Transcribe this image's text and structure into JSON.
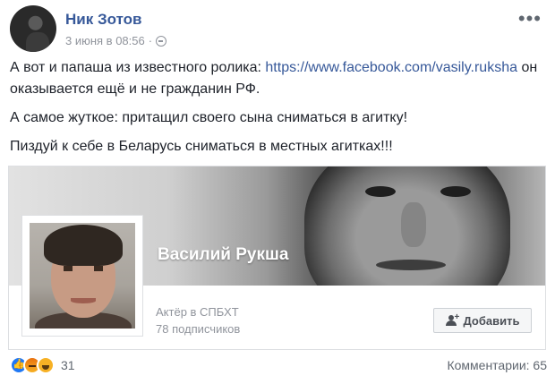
{
  "post": {
    "author": "Ник Зотов",
    "date": "3 июня в 08:56",
    "meta_separator": "·",
    "more_label": "•••"
  },
  "text": {
    "line1_before": "А вот и папаша из известного ролика: ",
    "line1_link": "https://www.facebook.com/vasily.ruksha",
    "line1_after": " он оказывается ещё и не гражданин РФ.",
    "line2": "А самое жуткое: притащил своего сына сниматься в агитку!",
    "line3": "Пиздуй к себе в Беларусь сниматься в местных агитках!!!"
  },
  "link_card": {
    "page_name": "Василий Рукша",
    "subtitle": "Актёр в СПБХТ",
    "followers": "78 подписчиков",
    "add_button_label": "Добавить"
  },
  "footer": {
    "reaction_count": "31",
    "comments_label": "Комментарии: 65"
  },
  "icons": {
    "globe": "globe-icon",
    "more": "more-options-icon",
    "add_user": "add-user-icon",
    "like": "like-reaction-icon",
    "angry": "angry-reaction-icon",
    "haha": "haha-reaction-icon"
  },
  "colors": {
    "link": "#365899",
    "meta": "#90949c",
    "text": "#1d2129"
  }
}
